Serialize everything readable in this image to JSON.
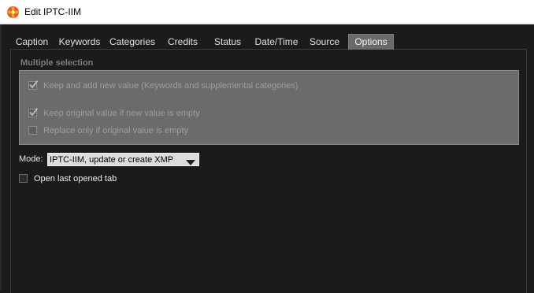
{
  "window": {
    "title": "Edit IPTC-IIM",
    "icon": "xnview-flower-icon"
  },
  "tabs": [
    {
      "label": "Caption",
      "active": false
    },
    {
      "label": "Keywords",
      "active": false
    },
    {
      "label": "Categories",
      "active": false
    },
    {
      "label": "Credits",
      "active": false
    },
    {
      "label": "Status",
      "active": false
    },
    {
      "label": "Date/Time",
      "active": false
    },
    {
      "label": "Source",
      "active": false
    },
    {
      "label": "Options",
      "active": true
    }
  ],
  "multiple_selection": {
    "title": "Multiple selection",
    "options": [
      {
        "label": "Keep and add new value (Keywords and supplemental categories)",
        "checked": true
      },
      {
        "label": "Keep original value if new value is empty",
        "checked": true
      },
      {
        "label": "Replace only if original value is empty",
        "checked": false
      }
    ]
  },
  "mode": {
    "label": "Mode:",
    "selected": "IPTC-IIM, update or create XMP"
  },
  "open_last_tab": {
    "label": "Open last opened tab",
    "checked": false
  },
  "colors": {
    "background": "#1b1b1b",
    "active_tab": "#6a6a6a",
    "group_box": "#6b6b6b"
  }
}
